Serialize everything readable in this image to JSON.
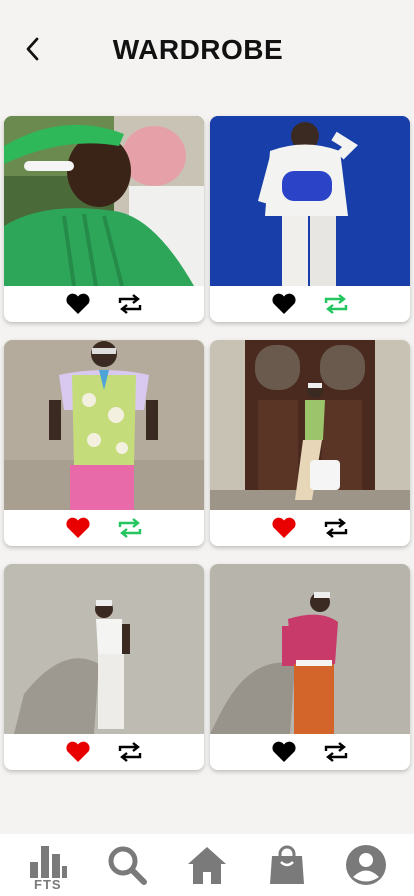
{
  "header": {
    "title": "WARDROBE"
  },
  "colors": {
    "liked": "#e80000",
    "unliked": "#000000",
    "reposted": "#22c55e",
    "not_reposted": "#000000",
    "nav_icon": "#7a7a7a"
  },
  "cards": [
    {
      "photo": "green-knit-sweater-outfit",
      "liked": false,
      "reposted": false
    },
    {
      "photo": "white-outfit-blue-bag",
      "liked": false,
      "reposted": true
    },
    {
      "photo": "green-vest-pink-pants-outfit",
      "liked": true,
      "reposted": true
    },
    {
      "photo": "green-vest-wooden-door",
      "liked": true,
      "reposted": false
    },
    {
      "photo": "white-tank-white-pants-outfit",
      "liked": true,
      "reposted": false
    },
    {
      "photo": "pink-sweater-orange-pants-outfit",
      "liked": false,
      "reposted": false
    }
  ],
  "nav": {
    "brand_label": "FTS",
    "items": [
      "stats-icon",
      "search-icon",
      "home-icon",
      "shopping-bag-icon",
      "profile-icon"
    ]
  }
}
